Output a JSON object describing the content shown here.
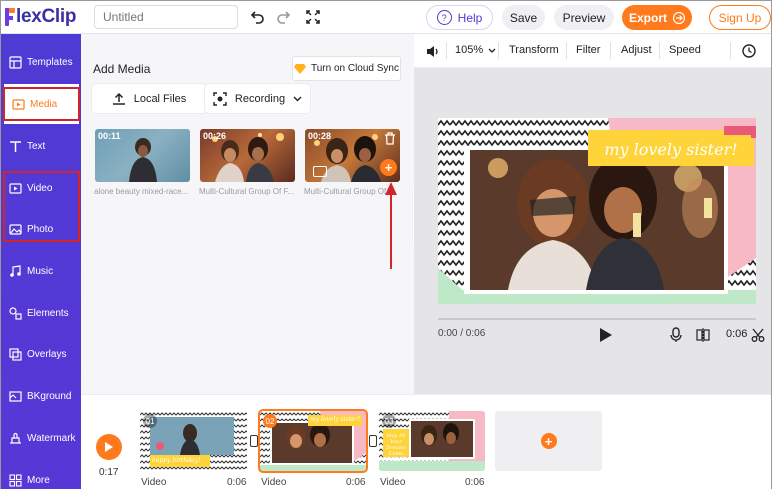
{
  "app": {
    "logo_text": "lexClip",
    "title_placeholder": "Untitled"
  },
  "header": {
    "help_label": "Help",
    "save_label": "Save",
    "preview_label": "Preview",
    "export_label": "Export",
    "signup_label": "Sign Up"
  },
  "nav": {
    "items": [
      {
        "label": "Templates",
        "icon": "templates-icon"
      },
      {
        "label": "Media",
        "icon": "media-icon",
        "active": true
      },
      {
        "label": "Text",
        "icon": "text-icon"
      },
      {
        "label": "Video",
        "icon": "video-icon"
      },
      {
        "label": "Photo",
        "icon": "photo-icon"
      },
      {
        "label": "Music",
        "icon": "music-icon"
      },
      {
        "label": "Elements",
        "icon": "elements-icon"
      },
      {
        "label": "Overlays",
        "icon": "overlays-icon"
      },
      {
        "label": "BKground",
        "icon": "background-icon"
      },
      {
        "label": "Watermark",
        "icon": "watermark-icon"
      },
      {
        "label": "More",
        "icon": "more-icon"
      }
    ]
  },
  "media_panel": {
    "title": "Add Media",
    "cloud_sync_label": "Turn on Cloud Sync",
    "local_files_label": "Local Files",
    "recording_label": "Recording",
    "items": [
      {
        "duration": "00:11",
        "caption": "alone beauty mixed-race..."
      },
      {
        "duration": "00:26",
        "caption": "Multi-Cultural Group Of F..."
      },
      {
        "duration": "00:28",
        "caption": "Multi-Cultural Group Of..."
      }
    ]
  },
  "toolbar": {
    "zoom": "105%",
    "transform_label": "Transform",
    "filter_label": "Filter",
    "adjust_label": "Adjust",
    "speed_label": "Speed"
  },
  "preview": {
    "canvas_title": "my lovely sister!",
    "current_time": "0:00 / 0:06",
    "duration": "0:06"
  },
  "timeline": {
    "current_time": "0:17",
    "clips": [
      {
        "number": "01",
        "label": "Video",
        "duration": "0:06",
        "caption": "happy birthday!"
      },
      {
        "number": "02",
        "label": "Video",
        "duration": "0:06",
        "caption": "my lovely sister!"
      },
      {
        "number": "03",
        "label": "Video",
        "duration": "0:06",
        "caption": "May All Your Dreams Come True!"
      }
    ]
  },
  "colors": {
    "brand_purple": "#4e3bd4",
    "accent_orange": "#ff7a1c",
    "annotation_red": "#d0262b"
  }
}
